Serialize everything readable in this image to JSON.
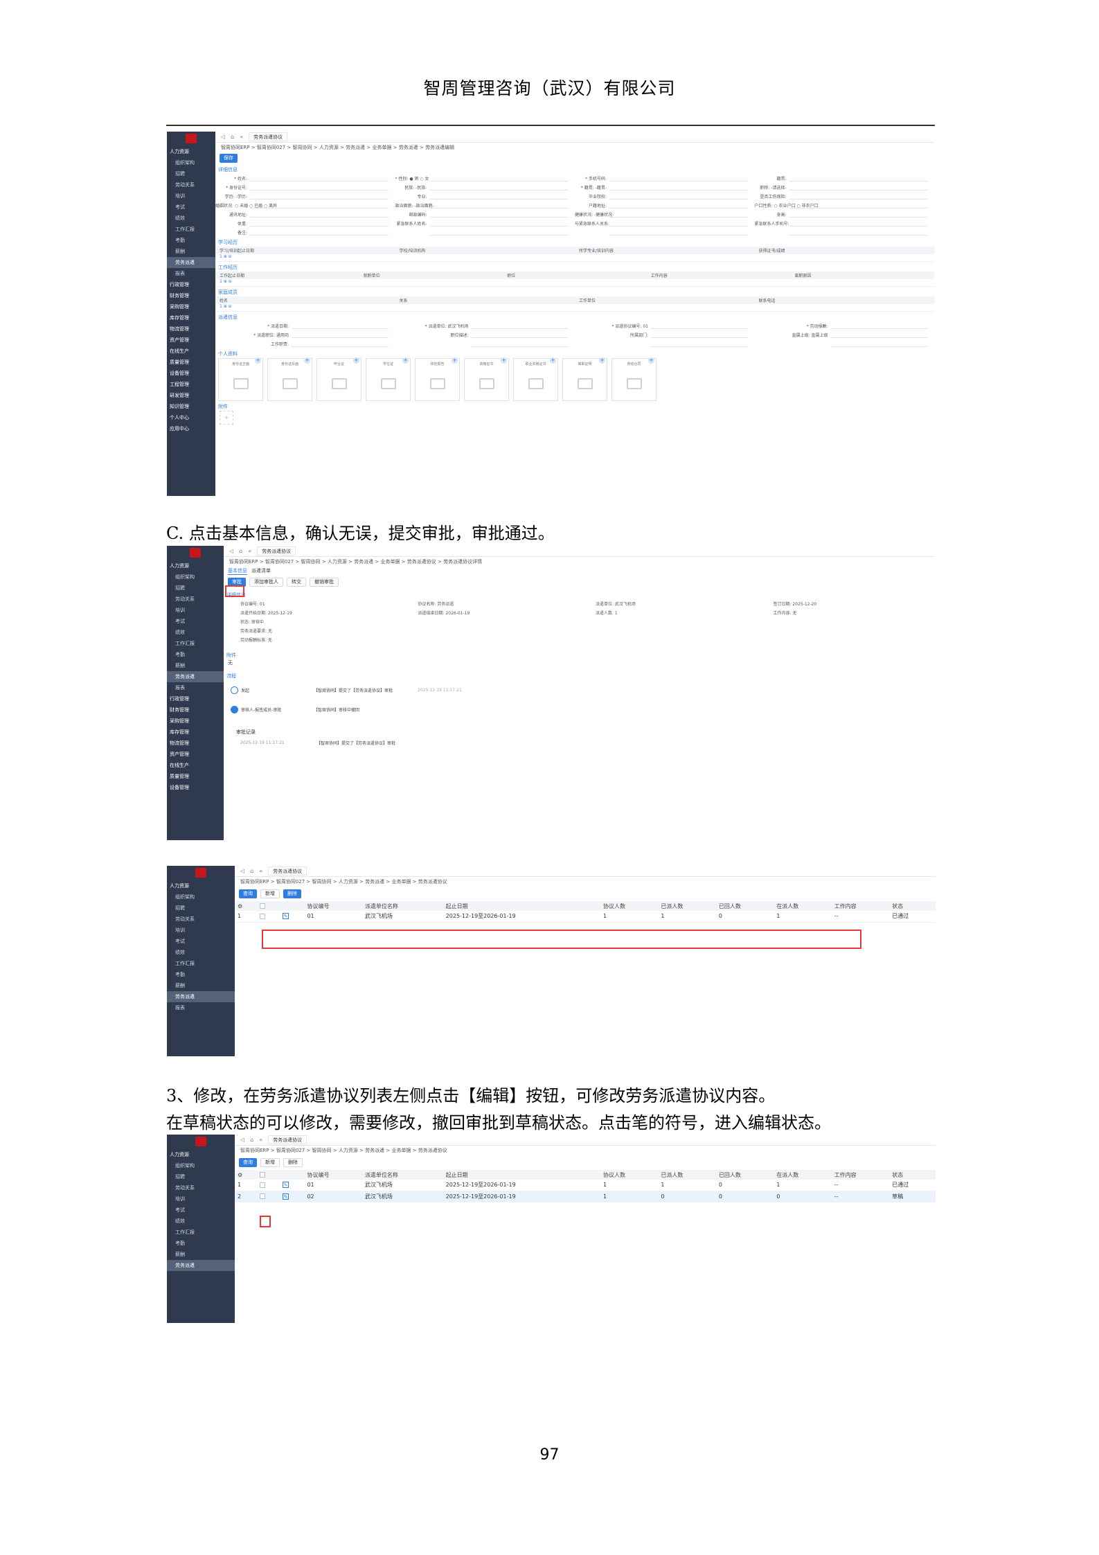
{
  "header": {
    "company": "智周管理咨询（武汉）有限公司"
  },
  "paragraphs": {
    "c_step": "C. 点击基本信息，确认无误，提交审批，审批通过。",
    "edit_line1": "3、修改，在劳务派遣协议列表左侧点击【编辑】按钮，可修改劳务派遣协议内容。",
    "edit_line2": "在草稿状态的可以修改，需要修改，撤回审批到草稿状态。点击笔的符号，进入编辑状态。"
  },
  "page_number": "97",
  "shot1": {
    "tab": "劳务派遣协议",
    "breadcrumb": "智周协同ERP > 智周协同027 > 智周协同 > 人力资源 > 劳务派遣 > 业务单据 > 劳务派遣 > 劳务派遣编辑",
    "save_label": "保存",
    "sections": [
      "详细信息",
      "学习经历",
      "工作经历",
      "家庭成员",
      "派遣信息",
      "个人资料",
      "附件"
    ],
    "form_rows": [
      [
        "* 姓名:",
        "* 性别: ● 男 ○ 女",
        "* 手机号码:",
        "籍贯:"
      ],
      [
        "* 身份证号:",
        "民族: -民族-",
        "* 籍贯: -籍贯-",
        "职称: -请选择-"
      ],
      [
        "学历: -学历-",
        "专业:",
        "毕业院校:",
        "是否工伤保险:"
      ],
      [
        "婚姻状况: ○ 未婚 ○ 已婚 ○ 离异",
        "政治面貌: -政治面貌-",
        "户籍地址:",
        "户口性质: ○ 农业户口 ○ 非农户口"
      ],
      [
        "通讯地址:",
        "邮政编码:",
        "健康状况: -健康状况-",
        "身高:"
      ],
      [
        "体重:",
        "紧急联系人姓名:",
        "与紧急联系人关系:",
        "紧急联系人手机号:"
      ],
      [
        "备注:",
        "",
        "",
        ""
      ]
    ],
    "study_headers": [
      "学习/培训起止日期",
      "学校/培训机构",
      "所学专业/培训内容",
      "获得证书/成绩"
    ],
    "work_headers": [
      "工作起止日期",
      "就职单位",
      "职位",
      "工作内容",
      "离职原因"
    ],
    "family_headers": [
      "姓名",
      "关系",
      "工作单位",
      "联系电话"
    ],
    "dispatch_rows": [
      [
        "* 派遣日期:",
        "* 派遣单位: 武汉飞机场",
        "* 派遣协议编号: 01",
        "* 劳动报酬:"
      ],
      [
        "* 派遣职位: 通用岗",
        "职位描述:",
        "所属部门:",
        "直属上级: 直属上级"
      ],
      [
        "工作职责:",
        "",
        "",
        ""
      ]
    ],
    "photos": [
      "身份证正面",
      "身份证反面",
      "毕业证",
      "学位证",
      "体检报告",
      "资格证书",
      "职业资格证书",
      "离职证明",
      "劳动合同"
    ],
    "sidebar": [
      "人力资源",
      "组织架构",
      "招聘",
      "劳动关系",
      "培训",
      "考试",
      "绩效",
      "工作汇报",
      "考勤",
      "薪酬",
      "劳务派遣",
      "报表",
      "行政管理",
      "财务管理",
      "采购管理",
      "库存管理",
      "物流管理",
      "资产管理",
      "在线生产",
      "质量管理",
      "设备管理",
      "工程管理",
      "研发管理",
      "知识管理",
      "个人中心",
      "应用中心"
    ]
  },
  "shot2": {
    "tab": "劳务派遣协议",
    "breadcrumb": "智周协同ERP > 智周协同027 > 智周协同 > 人力资源 > 劳务派遣 > 业务单据 > 劳务派遣协议 > 劳务派遣协议详情",
    "tabs": [
      "基本信息",
      "派遣清单"
    ],
    "buttons": [
      "审批",
      "添加审批人",
      "转交",
      "撤销审批"
    ],
    "section": "详细信息",
    "details": [
      [
        "协议编号: 01",
        "协议名称: 劳务派遣",
        "派遣单位: 武汉飞机场",
        "签订日期: 2025-12-20"
      ],
      [
        "派遣开始日期: 2025-12-19",
        "派遣结束日期: 2026-01-19",
        "派遣人数: 1",
        "工作内容: 无"
      ],
      [
        "状态: 审核中",
        "",
        "",
        ""
      ],
      [
        "劳务派遣要求: 无",
        "",
        "",
        ""
      ],
      [
        "劳动报酬标准: 无",
        "",
        "",
        ""
      ]
    ],
    "attach_label": "附件",
    "attach_value": "无",
    "flow_label": "流程",
    "flow": [
      {
        "step": "发起",
        "text": "【智周协同】提交了【劳务派遣协议】审批",
        "time": "2025-12-19 11:17:21"
      },
      {
        "step": "审核人-报签成员-审批",
        "text": "【智周协同】审核中撤回",
        "time": ""
      }
    ],
    "record_label": "审批记录",
    "record": {
      "time": "2025-12-19 11:17:21",
      "text": "【智周协同】提交了【劳务派遣协议】审批"
    },
    "sidebar": [
      "人力资源",
      "组织架构",
      "招聘",
      "劳动关系",
      "培训",
      "考试",
      "绩效",
      "工作汇报",
      "考勤",
      "薪酬",
      "劳务派遣",
      "报表",
      "行政管理",
      "财务管理",
      "采购管理",
      "库存管理",
      "物流管理",
      "资产管理",
      "在线生产",
      "质量管理",
      "设备管理"
    ]
  },
  "shot3": {
    "tab": "劳务派遣协议",
    "breadcrumb": "智周协同ERP > 智周协同027 > 智周协同 > 人力资源 > 劳务派遣 > 业务单据 > 劳务派遣协议",
    "buttons": {
      "query": "查询",
      "add": "新增",
      "delete": "删除"
    },
    "headers": [
      "协议编号",
      "派遣单位名称",
      "起止日期",
      "协议人数",
      "已派人数",
      "已回人数",
      "在派人数",
      "工作内容",
      "状态"
    ],
    "rows": [
      [
        "01",
        "武汉飞机场",
        "2025-12-19至2026-01-19",
        "1",
        "1",
        "0",
        "1",
        "--",
        "已通过"
      ]
    ],
    "sidebar": [
      "人力资源",
      "组织架构",
      "招聘",
      "劳动关系",
      "培训",
      "考试",
      "绩效",
      "工作汇报",
      "考勤",
      "薪酬",
      "劳务派遣",
      "报表"
    ]
  },
  "shot4": {
    "tab": "劳务派遣协议",
    "breadcrumb": "智周协同ERP > 智周协同027 > 智周协同 > 人力资源 > 劳务派遣 > 业务单据 > 劳务派遣协议",
    "buttons": {
      "query": "查询",
      "add": "新增",
      "delete": "删除"
    },
    "headers": [
      "协议编号",
      "派遣单位名称",
      "起止日期",
      "协议人数",
      "已派人数",
      "已回人数",
      "在派人数",
      "工作内容",
      "状态"
    ],
    "rows": [
      [
        "01",
        "武汉飞机场",
        "2025-12-19至2026-01-19",
        "1",
        "1",
        "0",
        "1",
        "--",
        "已通过"
      ],
      [
        "02",
        "武汉飞机场",
        "2025-12-19至2026-01-19",
        "1",
        "0",
        "0",
        "0",
        "--",
        "草稿"
      ]
    ],
    "sidebar": [
      "人力资源",
      "组织架构",
      "招聘",
      "劳动关系",
      "培训",
      "考试",
      "绩效",
      "工作汇报",
      "考勤",
      "薪酬",
      "劳务派遣"
    ]
  }
}
